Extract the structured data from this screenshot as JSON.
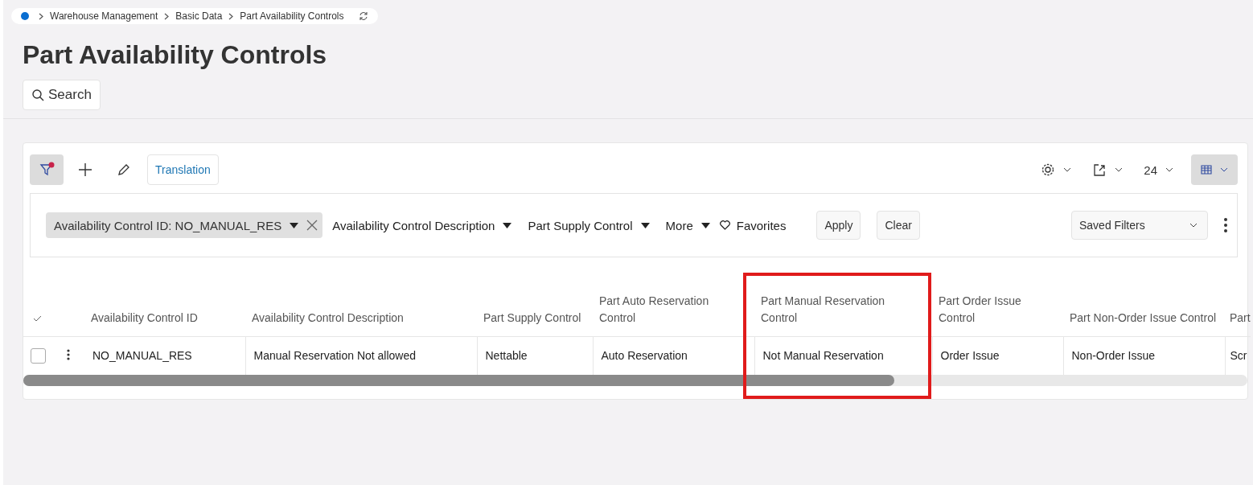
{
  "breadcrumb": [
    "Warehouse Management",
    "Basic Data",
    "Part Availability Controls"
  ],
  "title": "Part Availability Controls",
  "search_button": "Search",
  "toolbar": {
    "filter_active": true,
    "translation_button": "Translation",
    "page_size": "24"
  },
  "filters": [
    {
      "kind": "chip",
      "label": "Availability Control ID: NO_MANUAL_RES"
    },
    {
      "kind": "dropdown",
      "label": "Availability Control Description"
    },
    {
      "kind": "dropdown",
      "label": "Part Supply Control"
    },
    {
      "kind": "dropdown",
      "label": "More"
    },
    {
      "kind": "favorites",
      "label": "Favorites"
    }
  ],
  "filter_buttons": [
    "Apply",
    "Clear"
  ],
  "saved_filters": {
    "placeholder": "Saved Filters"
  },
  "table": {
    "columns": [
      {
        "label": "Availability Control ID",
        "highlighted": false
      },
      {
        "label": "Availability Control Description",
        "highlighted": false
      },
      {
        "label": "Part Supply Control",
        "highlighted": false
      },
      {
        "label": "Part Auto Reservation Control",
        "highlighted": false
      },
      {
        "label": "Part Manual Reservation Control",
        "highlighted": true
      },
      {
        "label": "Part Order Issue Control",
        "highlighted": false
      },
      {
        "label": "Part Non-Order Issue Control",
        "highlighted": false
      },
      {
        "label": "Part",
        "highlighted": false
      }
    ],
    "rows": [
      {
        "checked": false,
        "cells": [
          "NO_MANUAL_RES",
          "Manual Reservation Not allowed",
          "Nettable",
          "Auto Reservation",
          "Not Manual Reservation",
          "Order Issue",
          "Non-Order Issue",
          "Scr"
        ]
      }
    ]
  }
}
